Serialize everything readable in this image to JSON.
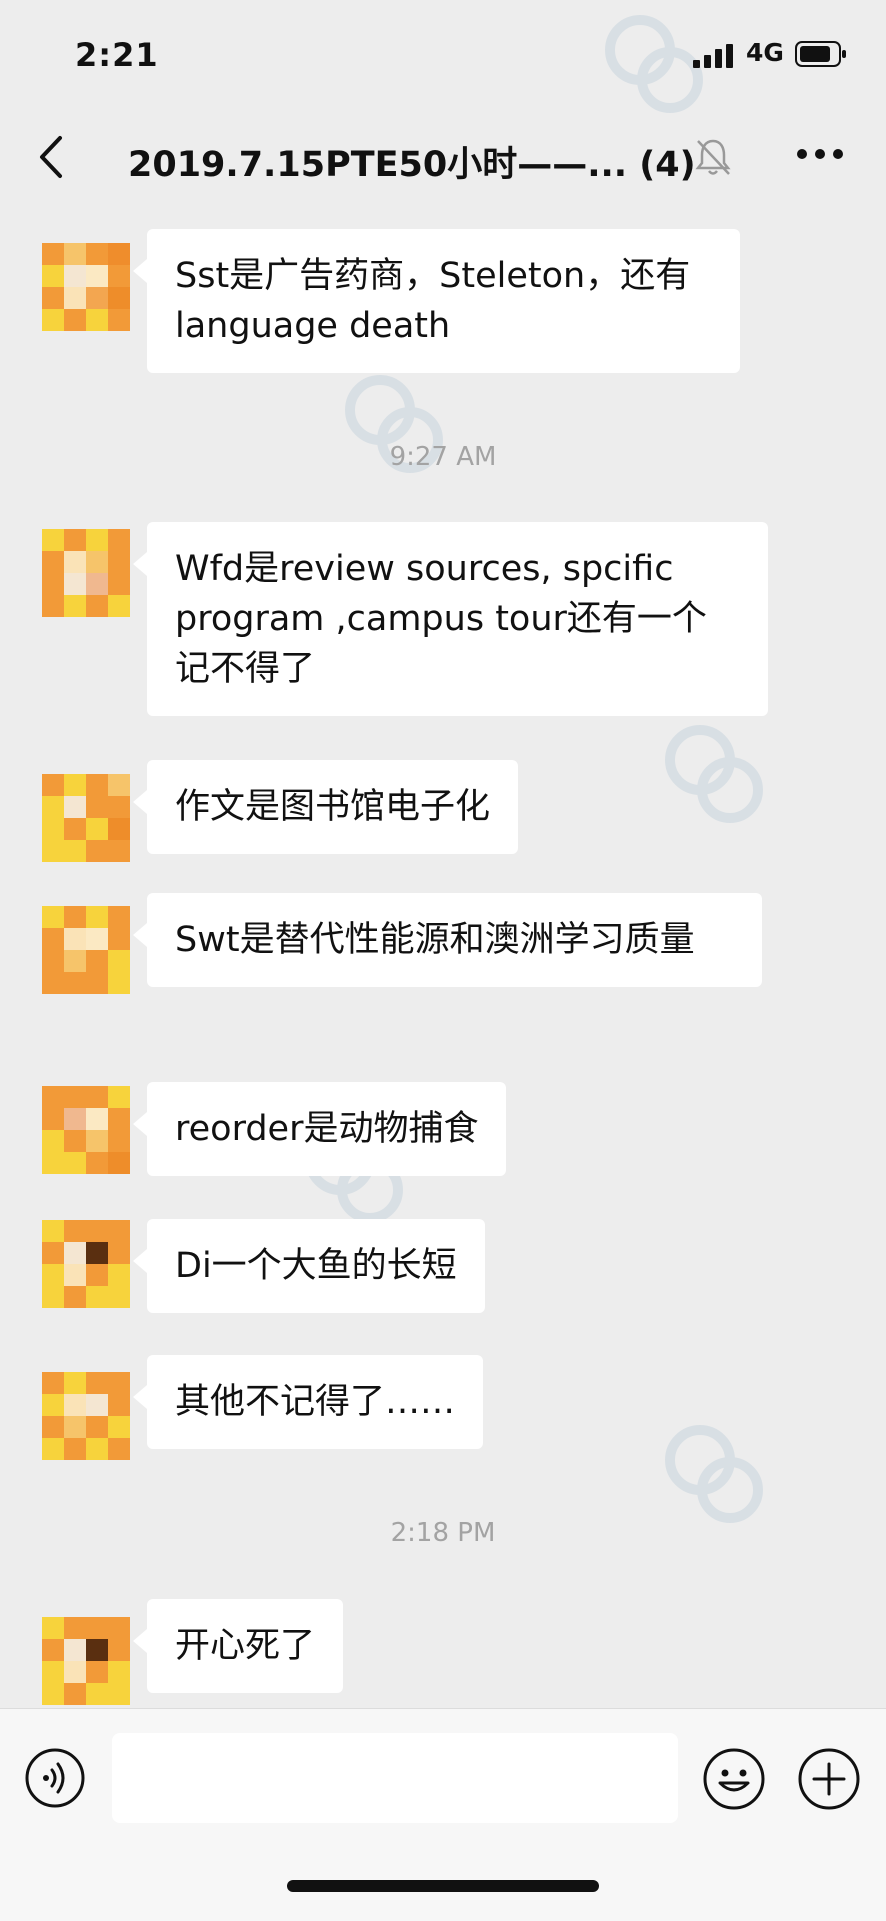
{
  "status_bar": {
    "time": "2:21",
    "network": "4G"
  },
  "chat": {
    "title": "2019.7.15PTE50小时——... (4)",
    "icons": {
      "back": "chevron-left-icon",
      "mute": "bell-mute-icon",
      "more": "more-dots-icon"
    }
  },
  "messages": [
    {
      "type": "text",
      "text": "Sst是广告药商，Steleton，还有language death"
    },
    {
      "type": "timestamp",
      "text": "9:27 AM"
    },
    {
      "type": "text",
      "text": "Wfd是review sources, spcific program ,campus tour还有一个记不得了"
    },
    {
      "type": "text",
      "text": "作文是图书馆电子化"
    },
    {
      "type": "text",
      "text": "Swt是替代性能源和澳洲学习质量"
    },
    {
      "type": "text",
      "text": "reorder是动物捕食"
    },
    {
      "type": "text",
      "text": "Di一个大鱼的长短"
    },
    {
      "type": "text",
      "text": "其他不记得了……"
    },
    {
      "type": "timestamp",
      "text": "2:18 PM"
    },
    {
      "type": "text",
      "text": "开心死了"
    }
  ],
  "input_bar": {
    "icons": {
      "voice": "voice-icon",
      "emoji": "emoji-icon",
      "plus": "plus-icon"
    }
  },
  "colors": {
    "background": "#ededed",
    "bubble": "#ffffff",
    "avatar_orange": "#f29a38",
    "avatar_yellow": "#f7d33c"
  }
}
